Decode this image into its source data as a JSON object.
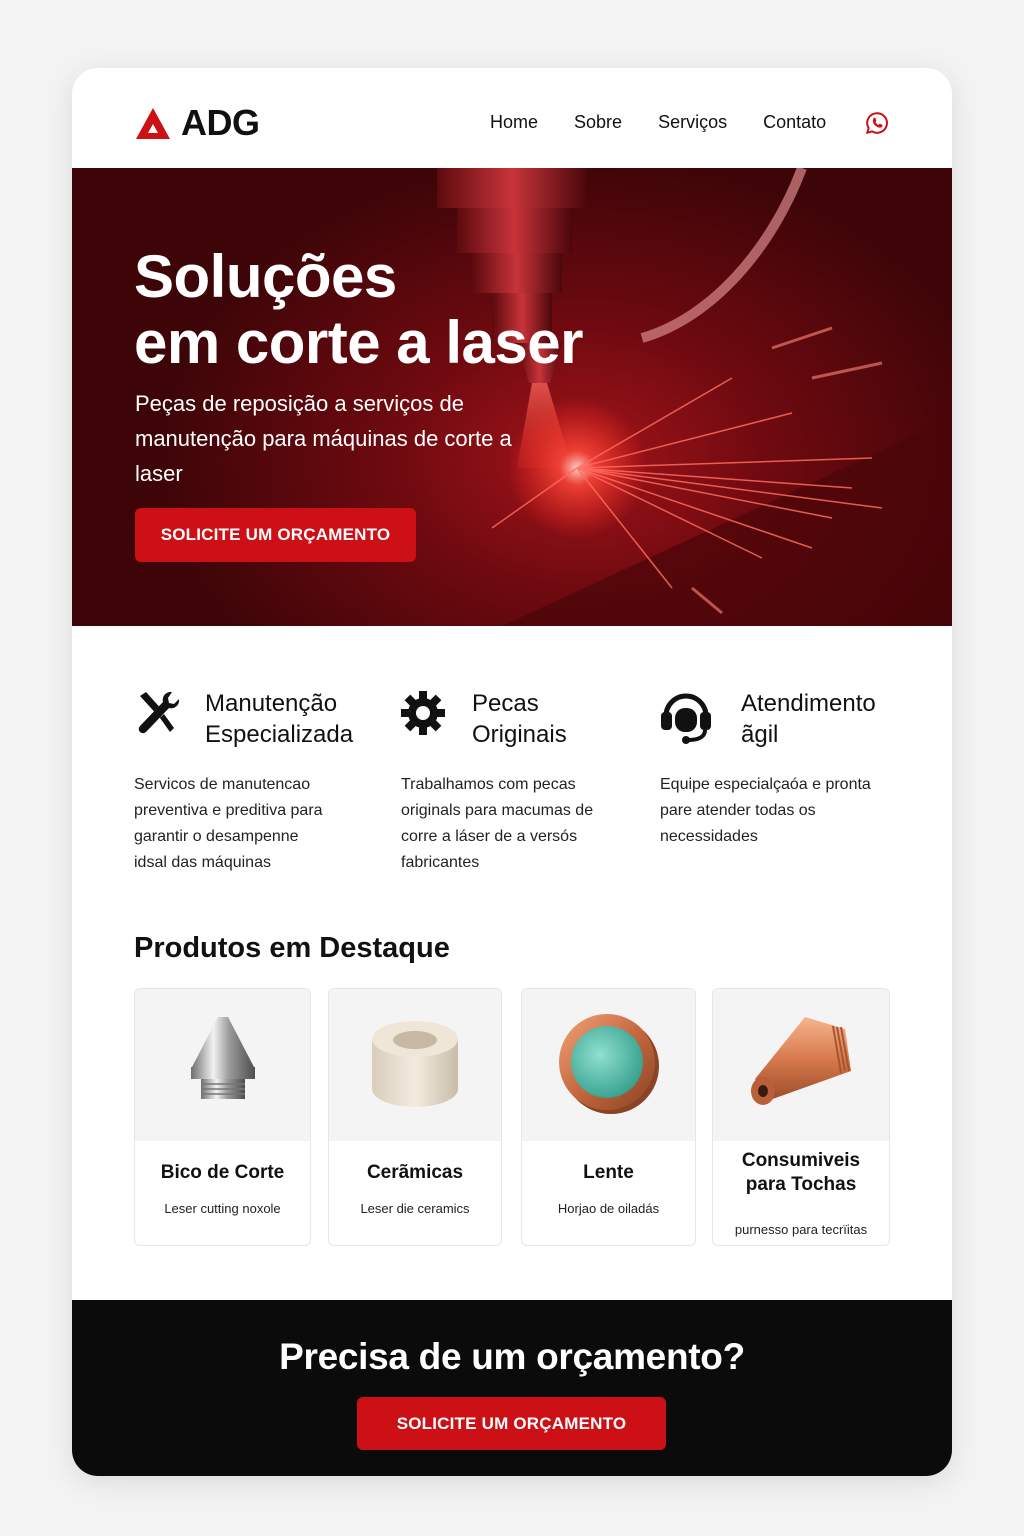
{
  "brand": {
    "name": "ADG",
    "accent_color": "#cc1016"
  },
  "nav": {
    "items": [
      "Home",
      "Sobre",
      "Serviços",
      "Contato"
    ],
    "contact_icon": "whatsapp-icon"
  },
  "hero": {
    "title_line1": "Soluções",
    "title_line2": "em corte a laser",
    "subtitle": "Peças de reposição a serviços de manutenção para máquinas de corte a laser",
    "cta_label": "SOLICITE UM ORÇAMENTO"
  },
  "features": [
    {
      "icon": "tools-icon",
      "title_line1": "Manutenção",
      "title_line2": "Especializada",
      "desc_lines": [
        "Servicos de manutencao",
        "preventiva e preditiva para",
        "garantir o desampenne",
        "idsal das máquinas"
      ]
    },
    {
      "icon": "gear-icon",
      "title_line1": "Pecas",
      "title_line2": "Originais",
      "desc_lines": [
        "Trabalhamos com pecas",
        "originals para macumas de",
        "corre a láser de a versós",
        "fabricantes"
      ]
    },
    {
      "icon": "headset-icon",
      "title_line1": "Atendimento",
      "title_line2": "ãgil",
      "desc_lines": [
        "Equipe especialçaóa e pronta",
        "pare atender todas os",
        "necessidades"
      ]
    }
  ],
  "products_section": {
    "title": "Produtos em Destaque",
    "items": [
      {
        "icon": "nozzle-icon",
        "name_line1": "Bico de Corte",
        "name_line2": "",
        "desc": "Leser cutting noxole"
      },
      {
        "icon": "ceramic-ring-icon",
        "name_line1": "Cerãmicas",
        "name_line2": "",
        "desc": "Leser die ceramics"
      },
      {
        "icon": "lens-icon",
        "name_line1": "Lente",
        "name_line2": "",
        "desc": "Horjao de oiladás"
      },
      {
        "icon": "torch-consumable-icon",
        "name_line1": "Consumiveis",
        "name_line2": "para Tochas",
        "desc": "purnesso para tecrïitas"
      }
    ]
  },
  "cta_footer": {
    "title": "Precisa de um orçamento?",
    "button_label": "SOLICITE UM ORÇAMENTO"
  }
}
